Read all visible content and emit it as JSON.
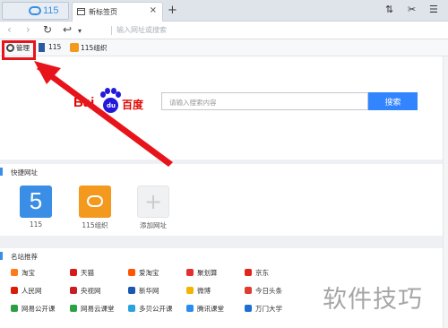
{
  "browser": {
    "logo_text": "115",
    "tab_title": "新标签页",
    "tab_close": "×",
    "new_tab": "+",
    "window_controls": [
      "⇅",
      "✂",
      "☰"
    ]
  },
  "navbar": {
    "back": "‹",
    "forward": "›",
    "reload": "↻",
    "undo": "↩",
    "undo_menu": "▾",
    "address_placeholder": "输入网址或搜索"
  },
  "bookmarks": [
    {
      "label": "管理",
      "icon": "gear-icon"
    },
    {
      "label": "115",
      "icon": "flag-icon"
    },
    {
      "label": "115组织",
      "icon": "cloud-icon"
    }
  ],
  "search": {
    "logo_prefix": "Bai",
    "logo_paw_text": "du",
    "logo_cn": "百度",
    "placeholder": "请输入搜索内容",
    "button_label": "搜索"
  },
  "quick": {
    "title": "快捷网址",
    "tiles": [
      {
        "label": "115",
        "glyph": "5"
      },
      {
        "label": "115组织"
      },
      {
        "label": "添加网址",
        "glyph": "+"
      }
    ]
  },
  "sites": {
    "title": "名站推荐",
    "rows": [
      [
        {
          "label": "淘宝",
          "color": "#ff7a1a"
        },
        {
          "label": "天猫",
          "color": "#d7191c"
        },
        {
          "label": "爱淘宝",
          "color": "#ff5500"
        },
        {
          "label": "聚划算",
          "color": "#e52e31"
        },
        {
          "label": "京东",
          "color": "#e1251b"
        }
      ],
      [
        {
          "label": "人民网",
          "color": "#d81e06"
        },
        {
          "label": "央视网",
          "color": "#c81d25"
        },
        {
          "label": "新华网",
          "color": "#1a57b3"
        },
        {
          "label": "微博",
          "color": "#f4b400"
        },
        {
          "label": "今日头条",
          "color": "#e03c31"
        }
      ],
      [
        {
          "label": "网易公开课",
          "color": "#2e9e44"
        },
        {
          "label": "网易云课堂",
          "color": "#2ba245"
        },
        {
          "label": "多贝公开课",
          "color": "#29a3e0"
        },
        {
          "label": "腾讯课堂",
          "color": "#2a8cf0"
        },
        {
          "label": "万门大学",
          "color": "#1f6fd1"
        }
      ]
    ]
  },
  "watermark": "软件技巧",
  "accent": "#3385ff",
  "highlight_color": "#e8141b"
}
